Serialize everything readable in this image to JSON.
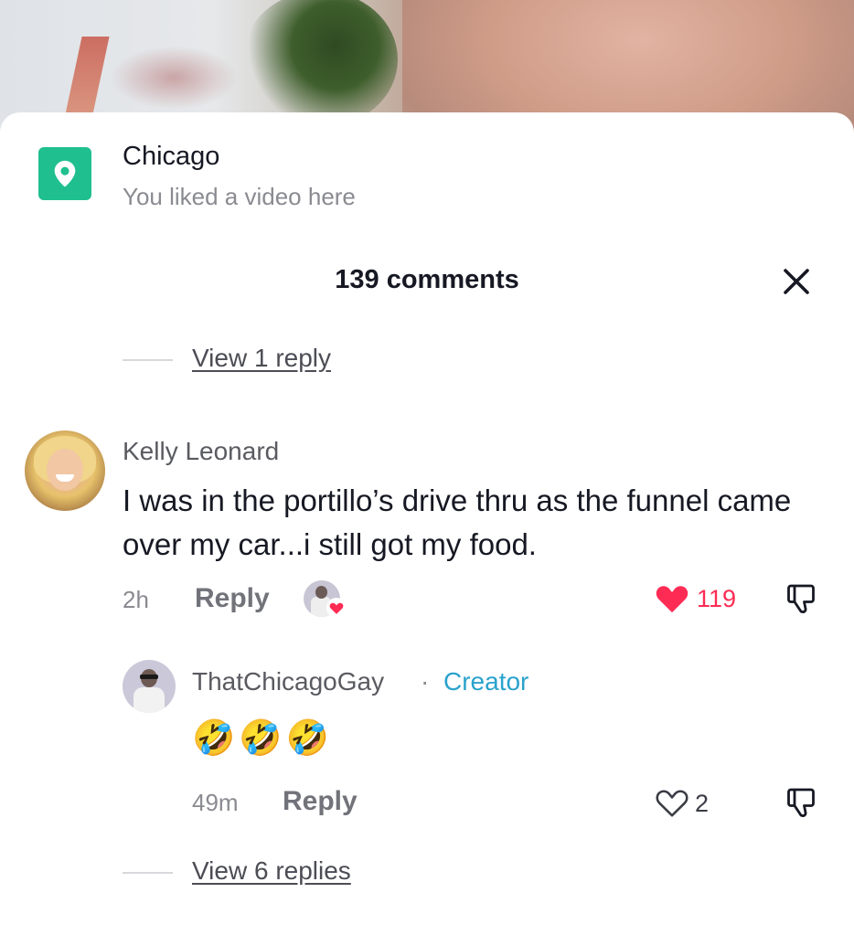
{
  "location": {
    "title": "Chicago",
    "subtitle": "You liked a video here",
    "icon": "location-pin-icon",
    "color": "#1fbf8f"
  },
  "header": {
    "comments_count": "139 comments",
    "close_icon": "close-icon"
  },
  "replies_top": {
    "label": "View 1 reply"
  },
  "comment": {
    "username": "Kelly Leonard",
    "text": "I was in the portillo’s drive thru as the funnel came over my car...i still got my food.",
    "time": "2h",
    "reply_label": "Reply",
    "likes": "119",
    "liked": true,
    "like_color": "#fe2c55",
    "liked_by_creator": true
  },
  "reply": {
    "username": "ThatChicagoGay",
    "separator": "·",
    "badge": "Creator",
    "badge_color": "#29a2cc",
    "text": "🤣🤣🤣",
    "time": "49m",
    "reply_label": "Reply",
    "likes": "2",
    "liked": false
  },
  "replies_bottom": {
    "label": "View 6 replies"
  }
}
